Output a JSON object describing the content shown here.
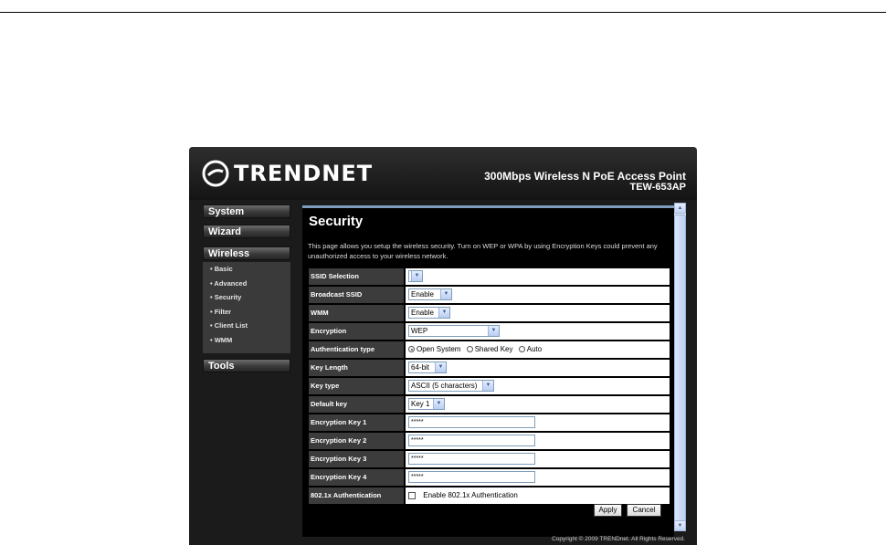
{
  "brand": {
    "logo_text": "TRENDNET",
    "product_name": "300Mbps Wireless N PoE Access Point",
    "model": "TEW-653AP"
  },
  "sidebar": {
    "menus": [
      {
        "label": "System"
      },
      {
        "label": "Wizard"
      },
      {
        "label": "Wireless"
      },
      {
        "label": "Tools"
      }
    ],
    "wireless_items": [
      {
        "label": "• Basic"
      },
      {
        "label": "• Advanced"
      },
      {
        "label": "• Security"
      },
      {
        "label": "• Filter"
      },
      {
        "label": "• Client List"
      },
      {
        "label": "• WMM"
      }
    ]
  },
  "page": {
    "title": "Security",
    "description": "This page allows you setup the wireless security. Turn on WEP or WPA by using Encryption Keys could prevent any unauthorized access to your wireless network."
  },
  "form": {
    "ssid_selection": {
      "label": "SSID Selection",
      "value": ""
    },
    "broadcast_ssid": {
      "label": "Broadcast SSID",
      "value": "Enable"
    },
    "wmm": {
      "label": "WMM",
      "value": "Enable"
    },
    "encryption": {
      "label": "Encryption",
      "value": "WEP"
    },
    "authentication_type": {
      "label": "Authentication type",
      "options": [
        "Open System",
        "Shared Key",
        "Auto"
      ],
      "selected": "Open System"
    },
    "key_length": {
      "label": "Key Length",
      "value": "64-bit"
    },
    "key_type": {
      "label": "Key type",
      "value": "ASCII (5 characters)"
    },
    "default_key": {
      "label": "Default key",
      "value": "Key 1"
    },
    "encryption_key_1": {
      "label": "Encryption Key 1",
      "value": "*****"
    },
    "encryption_key_2": {
      "label": "Encryption Key 2",
      "value": "*****"
    },
    "encryption_key_3": {
      "label": "Encryption Key 3",
      "value": "*****"
    },
    "encryption_key_4": {
      "label": "Encryption Key 4",
      "value": "*****"
    },
    "auth_8021x": {
      "label": "802.1x Authentication",
      "checkbox_label": "Enable 802.1x Authentication",
      "checked": false
    }
  },
  "buttons": {
    "apply": "Apply",
    "cancel": "Cancel"
  },
  "footer": {
    "copyright": "Copyright © 2009 TRENDnet. All Rights Reserved."
  },
  "colors": {
    "background": "#1b1b1b",
    "content_background": "#000000",
    "label_cell": "#3c3c3c",
    "accent_bar": "#7f9dbd"
  }
}
